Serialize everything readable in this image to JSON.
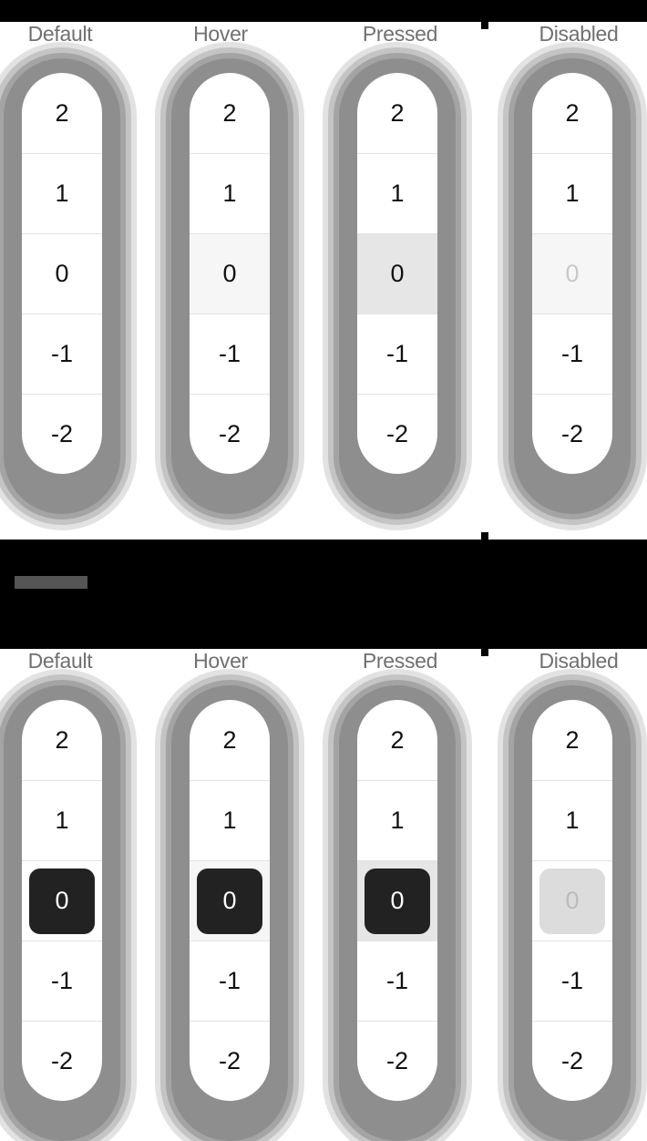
{
  "sections": [
    {
      "states": [
        {
          "label": "Default",
          "values": [
            "2",
            "1",
            "0",
            "-1",
            "-2"
          ],
          "selected": "0"
        },
        {
          "label": "Hover",
          "values": [
            "2",
            "1",
            "0",
            "-1",
            "-2"
          ],
          "selected": "0"
        },
        {
          "label": "Pressed",
          "values": [
            "2",
            "1",
            "0",
            "-1",
            "-2"
          ],
          "selected": "0"
        },
        {
          "label": "Disabled",
          "values": [
            "2",
            "1",
            "0",
            "-1",
            "-2"
          ],
          "selected": "0"
        }
      ]
    },
    {
      "states": [
        {
          "label": "Default",
          "values": [
            "2",
            "1",
            "0",
            "-1",
            "-2"
          ],
          "selected": "0"
        },
        {
          "label": "Hover",
          "values": [
            "2",
            "1",
            "0",
            "-1",
            "-2"
          ],
          "selected": "0"
        },
        {
          "label": "Pressed",
          "values": [
            "2",
            "1",
            "0",
            "-1",
            "-2"
          ],
          "selected": "0"
        },
        {
          "label": "Disabled",
          "values": [
            "2",
            "1",
            "0",
            "-1",
            "-2"
          ],
          "selected": "0"
        }
      ]
    }
  ],
  "colors": {
    "band": "#000000",
    "chip": "#222222",
    "chip_disabled": "#dcdcdc",
    "hover_row": "#f6f6f6",
    "pressed_row": "#e6e6e6",
    "label": "#707070"
  }
}
